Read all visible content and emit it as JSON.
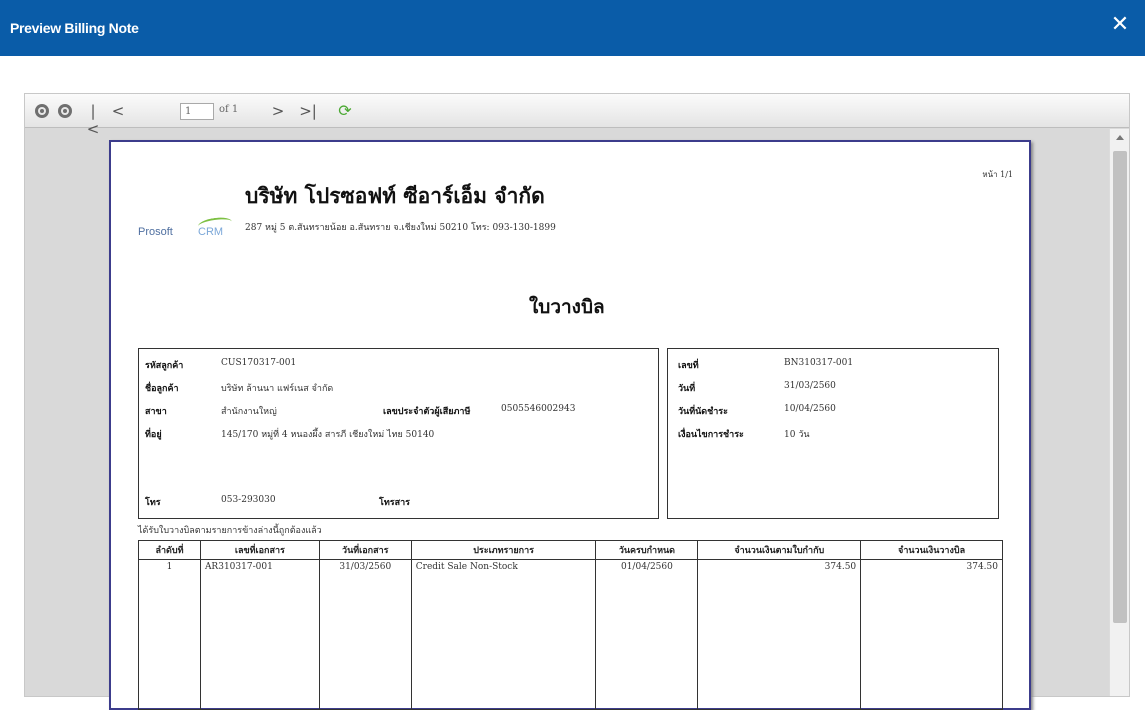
{
  "window": {
    "title": "Preview Billing Note",
    "close_icon": "close-icon"
  },
  "toolbar": {
    "page_value": "1",
    "page_of": "of 1",
    "icons": [
      "zoom-out-icon",
      "zoom-in-icon",
      "first-page-icon",
      "previous-page-icon",
      "next-page-icon",
      "last-page-icon",
      "refresh-icon"
    ]
  },
  "document": {
    "page_number": "หน้า 1/1",
    "logo_text_pro": "Prosoft",
    "logo_text_crm": "CRM",
    "company_name": "บริษัท โปรซอฟท์ ซีอาร์เอ็ม จำกัด",
    "company_address": "287 หมู่ 5 ต.สันทรายน้อย อ.สันทราย จ.เชียงใหม่ 50210 โทร: 093-130-1899",
    "title": "ใบวางบิล",
    "customer": {
      "code_label": "รหัสลูกค้า",
      "code": "CUS170317-001",
      "name_label": "ชื่อลูกค้า",
      "name": "บริษัท ล้านนา แฟร์เนส จำกัด",
      "branch_label": "สาขา",
      "branch": "สำนักงานใหญ่",
      "tax_label": "เลขประจำตัวผู้เสียภาษี",
      "tax_id": "0505546002943",
      "address_label": "ที่อยู่",
      "address": "145/170 หมู่ที่ 4 หนองผึ้ง สารภี เชียงใหม่ ไทย 50140",
      "phone_label": "โทร",
      "phone": "053-293030",
      "fax_label": "โทรสาร",
      "fax": ""
    },
    "billing": {
      "no_label": "เลขที่",
      "no": "BN310317-001",
      "date_label": "วันที่",
      "date": "31/03/2560",
      "due_label": "วันที่นัดชำระ",
      "due": "10/04/2560",
      "terms_label": "เงื่อนไขการชำระ",
      "terms": "10 วัน"
    },
    "note": "ได้รับใบวางบิลตามรายการข้างล่างนี้ถูกต้องแล้ว",
    "table": {
      "headers": [
        "ลำดับที่",
        "เลขที่เอกสาร",
        "วันที่เอกสาร",
        "ประเภทรายการ",
        "วันครบกำหนด",
        "จำนวนเงินตามใบกำกับ",
        "จำนวนเงินวางบิล"
      ],
      "rows": [
        [
          "1",
          "AR310317-001",
          "31/03/2560",
          "Credit Sale Non-Stock",
          "01/04/2560",
          "374.50",
          "374.50"
        ]
      ]
    }
  }
}
